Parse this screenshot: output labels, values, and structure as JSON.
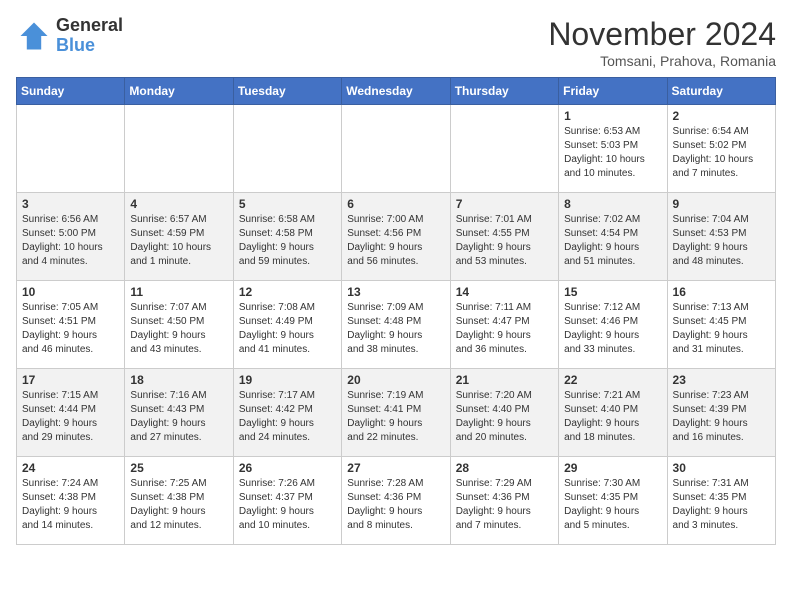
{
  "logo": {
    "general": "General",
    "blue": "Blue"
  },
  "title": "November 2024",
  "location": "Tomsani, Prahova, Romania",
  "days_header": [
    "Sunday",
    "Monday",
    "Tuesday",
    "Wednesday",
    "Thursday",
    "Friday",
    "Saturday"
  ],
  "weeks": [
    [
      {
        "day": "",
        "info": ""
      },
      {
        "day": "",
        "info": ""
      },
      {
        "day": "",
        "info": ""
      },
      {
        "day": "",
        "info": ""
      },
      {
        "day": "",
        "info": ""
      },
      {
        "day": "1",
        "info": "Sunrise: 6:53 AM\nSunset: 5:03 PM\nDaylight: 10 hours\nand 10 minutes."
      },
      {
        "day": "2",
        "info": "Sunrise: 6:54 AM\nSunset: 5:02 PM\nDaylight: 10 hours\nand 7 minutes."
      }
    ],
    [
      {
        "day": "3",
        "info": "Sunrise: 6:56 AM\nSunset: 5:00 PM\nDaylight: 10 hours\nand 4 minutes."
      },
      {
        "day": "4",
        "info": "Sunrise: 6:57 AM\nSunset: 4:59 PM\nDaylight: 10 hours\nand 1 minute."
      },
      {
        "day": "5",
        "info": "Sunrise: 6:58 AM\nSunset: 4:58 PM\nDaylight: 9 hours\nand 59 minutes."
      },
      {
        "day": "6",
        "info": "Sunrise: 7:00 AM\nSunset: 4:56 PM\nDaylight: 9 hours\nand 56 minutes."
      },
      {
        "day": "7",
        "info": "Sunrise: 7:01 AM\nSunset: 4:55 PM\nDaylight: 9 hours\nand 53 minutes."
      },
      {
        "day": "8",
        "info": "Sunrise: 7:02 AM\nSunset: 4:54 PM\nDaylight: 9 hours\nand 51 minutes."
      },
      {
        "day": "9",
        "info": "Sunrise: 7:04 AM\nSunset: 4:53 PM\nDaylight: 9 hours\nand 48 minutes."
      }
    ],
    [
      {
        "day": "10",
        "info": "Sunrise: 7:05 AM\nSunset: 4:51 PM\nDaylight: 9 hours\nand 46 minutes."
      },
      {
        "day": "11",
        "info": "Sunrise: 7:07 AM\nSunset: 4:50 PM\nDaylight: 9 hours\nand 43 minutes."
      },
      {
        "day": "12",
        "info": "Sunrise: 7:08 AM\nSunset: 4:49 PM\nDaylight: 9 hours\nand 41 minutes."
      },
      {
        "day": "13",
        "info": "Sunrise: 7:09 AM\nSunset: 4:48 PM\nDaylight: 9 hours\nand 38 minutes."
      },
      {
        "day": "14",
        "info": "Sunrise: 7:11 AM\nSunset: 4:47 PM\nDaylight: 9 hours\nand 36 minutes."
      },
      {
        "day": "15",
        "info": "Sunrise: 7:12 AM\nSunset: 4:46 PM\nDaylight: 9 hours\nand 33 minutes."
      },
      {
        "day": "16",
        "info": "Sunrise: 7:13 AM\nSunset: 4:45 PM\nDaylight: 9 hours\nand 31 minutes."
      }
    ],
    [
      {
        "day": "17",
        "info": "Sunrise: 7:15 AM\nSunset: 4:44 PM\nDaylight: 9 hours\nand 29 minutes."
      },
      {
        "day": "18",
        "info": "Sunrise: 7:16 AM\nSunset: 4:43 PM\nDaylight: 9 hours\nand 27 minutes."
      },
      {
        "day": "19",
        "info": "Sunrise: 7:17 AM\nSunset: 4:42 PM\nDaylight: 9 hours\nand 24 minutes."
      },
      {
        "day": "20",
        "info": "Sunrise: 7:19 AM\nSunset: 4:41 PM\nDaylight: 9 hours\nand 22 minutes."
      },
      {
        "day": "21",
        "info": "Sunrise: 7:20 AM\nSunset: 4:40 PM\nDaylight: 9 hours\nand 20 minutes."
      },
      {
        "day": "22",
        "info": "Sunrise: 7:21 AM\nSunset: 4:40 PM\nDaylight: 9 hours\nand 18 minutes."
      },
      {
        "day": "23",
        "info": "Sunrise: 7:23 AM\nSunset: 4:39 PM\nDaylight: 9 hours\nand 16 minutes."
      }
    ],
    [
      {
        "day": "24",
        "info": "Sunrise: 7:24 AM\nSunset: 4:38 PM\nDaylight: 9 hours\nand 14 minutes."
      },
      {
        "day": "25",
        "info": "Sunrise: 7:25 AM\nSunset: 4:38 PM\nDaylight: 9 hours\nand 12 minutes."
      },
      {
        "day": "26",
        "info": "Sunrise: 7:26 AM\nSunset: 4:37 PM\nDaylight: 9 hours\nand 10 minutes."
      },
      {
        "day": "27",
        "info": "Sunrise: 7:28 AM\nSunset: 4:36 PM\nDaylight: 9 hours\nand 8 minutes."
      },
      {
        "day": "28",
        "info": "Sunrise: 7:29 AM\nSunset: 4:36 PM\nDaylight: 9 hours\nand 7 minutes."
      },
      {
        "day": "29",
        "info": "Sunrise: 7:30 AM\nSunset: 4:35 PM\nDaylight: 9 hours\nand 5 minutes."
      },
      {
        "day": "30",
        "info": "Sunrise: 7:31 AM\nSunset: 4:35 PM\nDaylight: 9 hours\nand 3 minutes."
      }
    ]
  ]
}
